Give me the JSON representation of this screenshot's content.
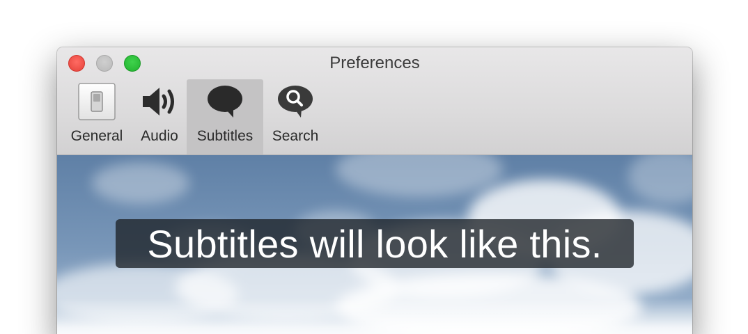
{
  "window": {
    "title": "Preferences"
  },
  "toolbar": {
    "tabs": [
      {
        "label": "General",
        "icon": "light-switch-icon",
        "selected": false
      },
      {
        "label": "Audio",
        "icon": "speaker-icon",
        "selected": false
      },
      {
        "label": "Subtitles",
        "icon": "speech-bubble-icon",
        "selected": true
      },
      {
        "label": "Search",
        "icon": "search-bubble-icon",
        "selected": false
      }
    ]
  },
  "preview": {
    "subtitle_text": "Subtitles will look like this.",
    "background": "sky-with-clouds"
  },
  "colors": {
    "close": "#ff5f57",
    "minimize": "#c6c6c6",
    "zoom": "#28c840",
    "selected_tab": "#c4c3c4",
    "sky": "#6d8db0",
    "subtitle_bg": "#1e2228"
  }
}
